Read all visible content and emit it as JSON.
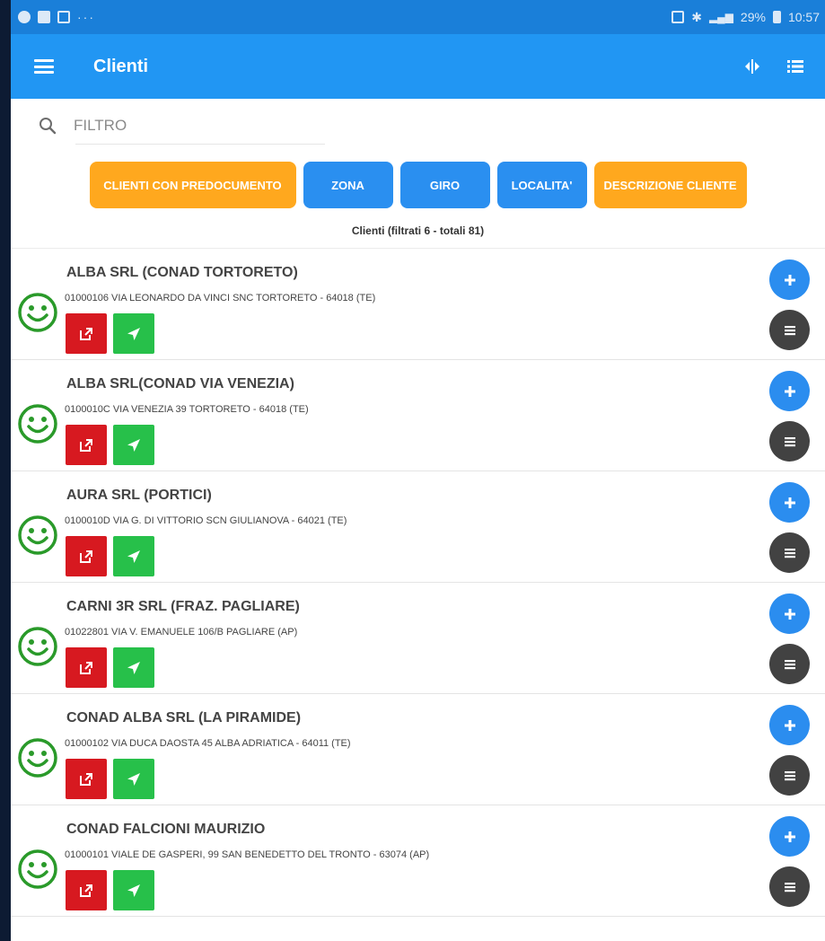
{
  "status_bar": {
    "left_icons": [
      "alarm-icon",
      "gallery-icon",
      "mail-icon"
    ],
    "dots": "···",
    "right_text": "29%",
    "time": "10:57",
    "right_icons": [
      "nfc-icon",
      "bluetooth-icon",
      "wifi-signal-icon",
      "battery-icon"
    ]
  },
  "app_bar": {
    "title": "Clienti",
    "actions": [
      "split-view-icon",
      "list-view-icon"
    ]
  },
  "search": {
    "placeholder": "FILTRO"
  },
  "filters": [
    {
      "label": "CLIENTI CON PREDOCUMENTO",
      "color": "#ffa81e"
    },
    {
      "label": "ZONA",
      "color": "#2a8ff0"
    },
    {
      "label": "GIRO",
      "color": "#2a8ff0"
    },
    {
      "label": "LOCALITA'",
      "color": "#2a8ff0"
    },
    {
      "label": "DESCRIZIONE CLIENTE",
      "color": "#ffa81e"
    }
  ],
  "count_text": "Clienti (filtrati 6 - totali 81)",
  "clients": [
    {
      "name": "ALBA SRL (CONAD TORTORETO)",
      "address": "01000106 VIA LEONARDO DA VINCI SNC TORTORETO - 64018 (TE)"
    },
    {
      "name": "ALBA SRL(CONAD VIA VENEZIA)",
      "address": "0100010C VIA VENEZIA 39 TORTORETO - 64018 (TE)"
    },
    {
      "name": "AURA SRL (PORTICI)",
      "address": "0100010D VIA G. DI VITTORIO SCN GIULIANOVA - 64021 (TE)"
    },
    {
      "name": "CARNI 3R SRL (FRAZ. PAGLIARE)",
      "address": "01022801 VIA V. EMANUELE 106/B PAGLIARE (AP)"
    },
    {
      "name": "CONAD ALBA SRL (LA PIRAMIDE)",
      "address": "01000102 VIA DUCA DAOSTA 45 ALBA ADRIATICA - 64011 (TE)"
    },
    {
      "name": "CONAD FALCIONI MAURIZIO",
      "address": "01000101 VIALE  DE GASPERI, 99 SAN BENEDETTO DEL TRONTO - 63074 (AP)"
    }
  ],
  "colors": {
    "status_bar": "#1a7fd9",
    "app_bar": "#2196f3",
    "open_button": "#d71920",
    "navigate_button": "#27c04a",
    "add_fab": "#2b8def",
    "menu_fab": "#424242",
    "smiley": "#2a9a2a"
  }
}
